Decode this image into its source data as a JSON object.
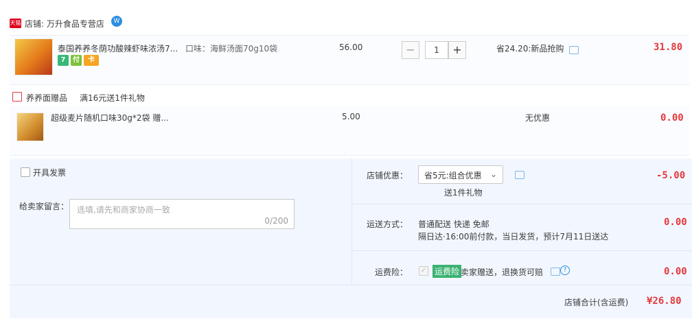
{
  "shop": {
    "badge": "天猫",
    "label": "店铺: 万升食品专营店",
    "ww": "W"
  },
  "item1": {
    "title": "泰国养养冬荫功酸辣虾味浓汤7...",
    "sku": "口味：海鲜汤面70g10袋",
    "price": "56.00",
    "qty": "1",
    "qty_minus": "−",
    "qty_plus": "+",
    "promo": "省24.20:新品抢购",
    "subtotal": "31.80",
    "services": [
      {
        "name": "7",
        "color": "#36b878"
      },
      {
        "name": "付",
        "color": "#7cc13a"
      },
      {
        "name": "卡",
        "color": "#f5a623"
      }
    ]
  },
  "gift": {
    "header": "养养面赠品",
    "rule": "满16元送1件礼物",
    "title": "超级麦片随机口味30g*2袋 赠...",
    "price": "5.00",
    "promo": "无优惠",
    "subtotal": "0.00"
  },
  "invoice": {
    "label": "开具发票"
  },
  "message": {
    "label": "给卖家留言：",
    "placeholder": "选填,请先和商家协商一致",
    "counter": "0/200"
  },
  "discount": {
    "label": "店铺优惠：",
    "selected": "省5元:组合优惠",
    "note": "送1件礼物",
    "amount": "-5.00"
  },
  "shipping": {
    "label": "运送方式：",
    "method": "普通配送 快递 免邮",
    "detail": "隔日达·16:00前付款，当日发货，预计7月11日送达",
    "amount": "0.00"
  },
  "insurance": {
    "label": "运费险：",
    "badge": "运费险",
    "desc": "卖家赠送，退换货可赔",
    "amount": "0.00"
  },
  "total": {
    "label": "店铺合计(含运费)",
    "amount": "¥26.80"
  },
  "colors": {
    "price_red": "#e4393c",
    "accent_blue": "#2e8fe0",
    "badge_green": "#3bb272"
  }
}
